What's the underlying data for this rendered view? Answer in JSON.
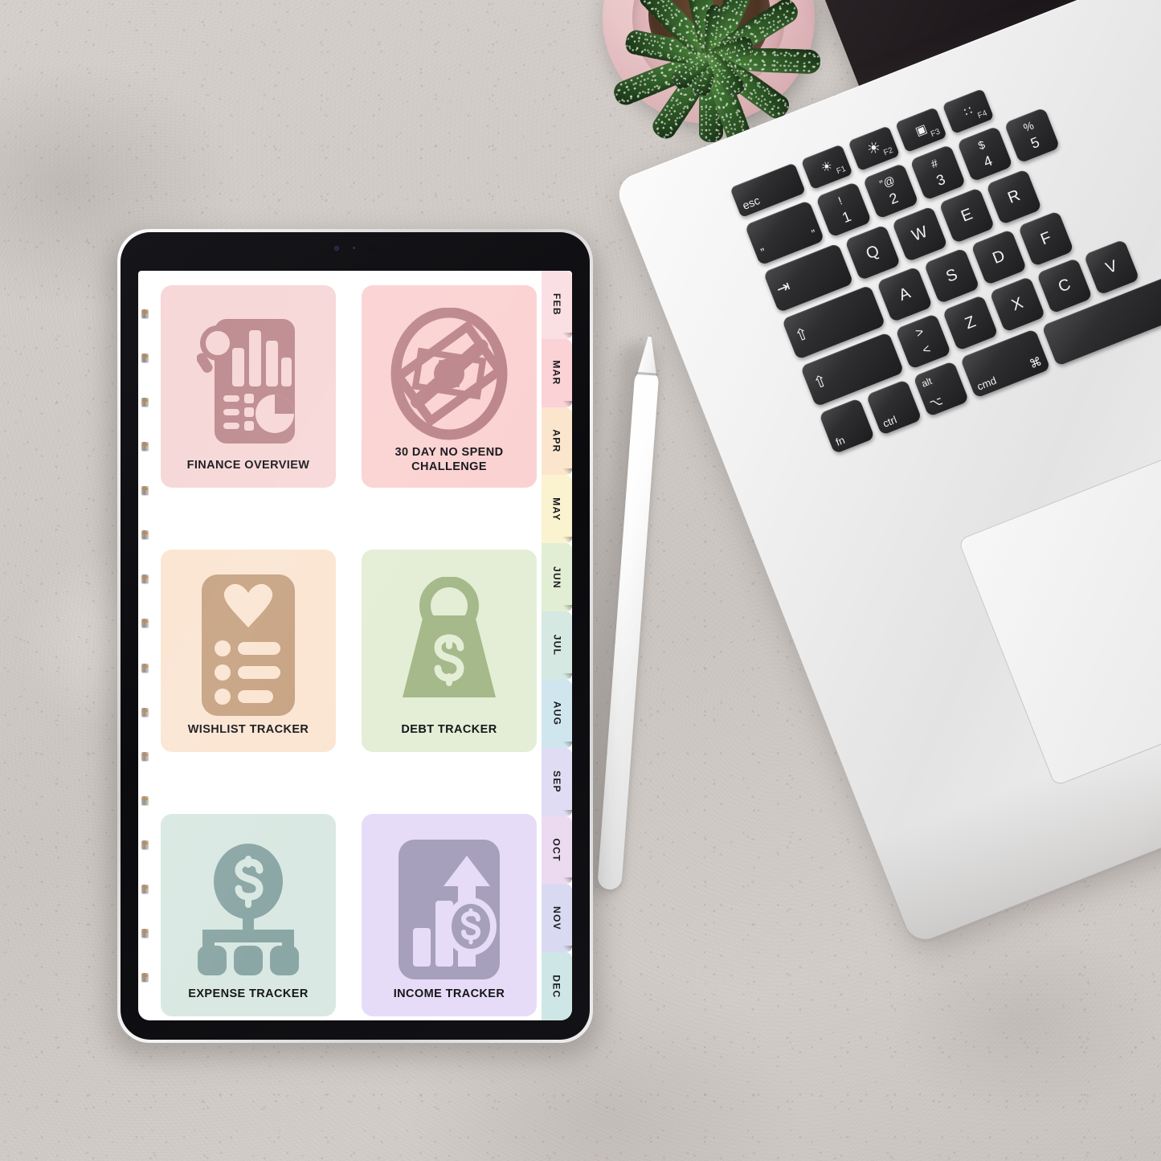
{
  "scene": {
    "background_color": "#d2cdc9",
    "description": "flat-lay desk"
  },
  "tablet": {
    "device_name": "tablet",
    "bezel_color": "#101014",
    "frame_color": "#e8e8e8",
    "screen_background": "#ffffff"
  },
  "planner": {
    "cards": [
      {
        "id": "finance-overview",
        "label": "FINANCE OVERVIEW",
        "icon": "finance-report-icon",
        "bg_color": "#f7d7d7",
        "icon_color": "#bd8b8f",
        "lines": 1
      },
      {
        "id": "no-spend-challenge",
        "label": "30 DAY NO SPEND CHALLENGE",
        "label_line1": "30 DAY NO SPEND",
        "label_line2": "CHALLENGE",
        "icon": "no-money-icon",
        "bg_color": "#fbd2d2",
        "icon_color": "#bb858b",
        "lines": 2
      },
      {
        "id": "wishlist-tracker",
        "label": "WISHLIST TRACKER",
        "icon": "wishlist-heart-list-icon",
        "bg_color": "#fbe5d2",
        "icon_color": "#c6a281",
        "lines": 1
      },
      {
        "id": "debt-tracker",
        "label": "DEBT TRACKER",
        "icon": "debt-weight-icon",
        "bg_color": "#e4eed6",
        "icon_color": "#a5b98a",
        "lines": 1
      },
      {
        "id": "expense-tracker",
        "label": "EXPENSE TRACKER",
        "icon": "expense-hierarchy-icon",
        "bg_color": "#d9e8e2",
        "icon_color": "#8ba7a5",
        "lines": 1
      },
      {
        "id": "income-tracker",
        "label": "INCOME TRACKER",
        "icon": "income-growth-icon",
        "bg_color": "#e6dcf7",
        "icon_color": "#a6a0bd",
        "lines": 1
      }
    ],
    "month_tabs": [
      {
        "label": "FEB",
        "color": "#fadfe3"
      },
      {
        "label": "MAR",
        "color": "#fbd2d6"
      },
      {
        "label": "APR",
        "color": "#fbe6cd"
      },
      {
        "label": "MAY",
        "color": "#fbf2cf"
      },
      {
        "label": "JUN",
        "color": "#e2eed4"
      },
      {
        "label": "JUL",
        "color": "#d5e8e2"
      },
      {
        "label": "AUG",
        "color": "#cfe6ef"
      },
      {
        "label": "SEP",
        "color": "#e0dcf3"
      },
      {
        "label": "OCT",
        "color": "#ecdaf1"
      },
      {
        "label": "NOV",
        "color": "#d9daf2"
      },
      {
        "label": "DEC",
        "color": "#cfe6e6"
      }
    ]
  },
  "laptop": {
    "device_name": "laptop",
    "body_color": "#ededed",
    "key_color": "#26262a",
    "keys_row_function": [
      {
        "label": "esc",
        "fn": ""
      },
      {
        "label": "☀",
        "fn": "F1"
      },
      {
        "label": "☀",
        "fn": "F2"
      },
      {
        "label": "▣",
        "fn": "F3"
      },
      {
        "label": "∷",
        "fn": "F4"
      }
    ],
    "keys_row_numbers": [
      {
        "top": "”",
        "bottom": "”"
      },
      {
        "top": "!",
        "bottom": "1"
      },
      {
        "top": "”@",
        "bottom": "2"
      },
      {
        "top": "#",
        "bottom": "3"
      },
      {
        "top": "$",
        "bottom": "4"
      },
      {
        "top": "%",
        "bottom": "5"
      }
    ],
    "keys_row_qwerty": [
      "⇥",
      "Q",
      "W",
      "E",
      "R"
    ],
    "keys_row_asdf": [
      "⇧",
      "A",
      "S",
      "D",
      "F"
    ],
    "keys_row_zxcv": [
      "⇧",
      "><",
      "Z",
      "X",
      "C",
      "V"
    ],
    "keys_row_modifier": [
      "fn",
      "ctrl",
      "alt",
      "cmd"
    ],
    "cmd_symbol": "⌘"
  },
  "accessories": {
    "stylus": {
      "name": "stylus-pen",
      "color": "#ffffff"
    },
    "plant": {
      "name": "succulent-plant",
      "pot_color": "#e2b8bc",
      "leaf_color": "#2f5a27"
    }
  }
}
